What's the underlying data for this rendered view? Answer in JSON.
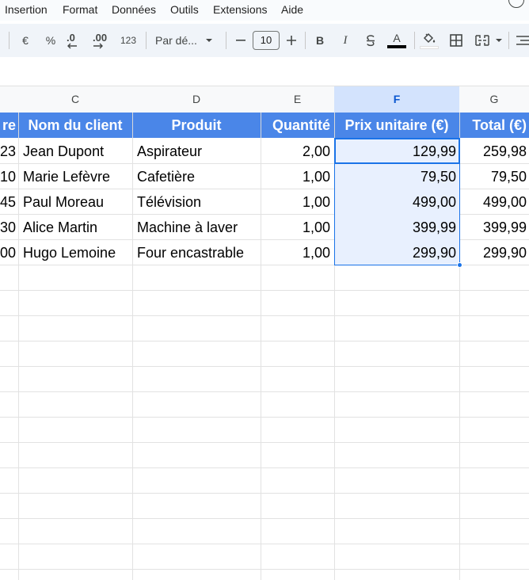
{
  "menu": {
    "items": [
      "Insertion",
      "Format",
      "Données",
      "Outils",
      "Extensions",
      "Aide"
    ]
  },
  "toolbar": {
    "currency_label": "€",
    "percent_label": "%",
    "decrease_decimals_label": ".0",
    "increase_decimals_label": ".00",
    "number_format_label": "123",
    "font_name": "Par dé...",
    "font_size": "10",
    "bold_label": "B",
    "italic_label": "I",
    "text_color_label": "A"
  },
  "columns": {
    "headers": [
      "C",
      "D",
      "E",
      "F",
      "G"
    ],
    "selected": "F"
  },
  "table": {
    "partial_header": "re",
    "headers": [
      "Nom du client",
      "Produit",
      "Quantité",
      "Prix unitaire (€)",
      "Total (€)"
    ],
    "rows": [
      {
        "partial": "23",
        "client": "Jean Dupont",
        "produit": "Aspirateur",
        "quantite": "2,00",
        "prix": "129,99",
        "total": "259,98"
      },
      {
        "partial": "10",
        "client": "Marie Lefèvre",
        "produit": "Cafetière",
        "quantite": "1,00",
        "prix": "79,50",
        "total": "79,50"
      },
      {
        "partial": "45",
        "client": "Paul Moreau",
        "produit": "Télévision",
        "quantite": "1,00",
        "prix": "499,00",
        "total": "499,00"
      },
      {
        "partial": "30",
        "client": "Alice Martin",
        "produit": "Machine à laver",
        "quantite": "1,00",
        "prix": "399,99",
        "total": "399,99"
      },
      {
        "partial": "00",
        "client": "Hugo Lemoine",
        "produit": "Four encastrable",
        "quantite": "1,00",
        "prix": "299,90",
        "total": "299,90"
      }
    ]
  },
  "colors": {
    "header_fill": "#4a86e8",
    "selection": "#1a73e8",
    "selected_fill": "#e8f0fe"
  }
}
